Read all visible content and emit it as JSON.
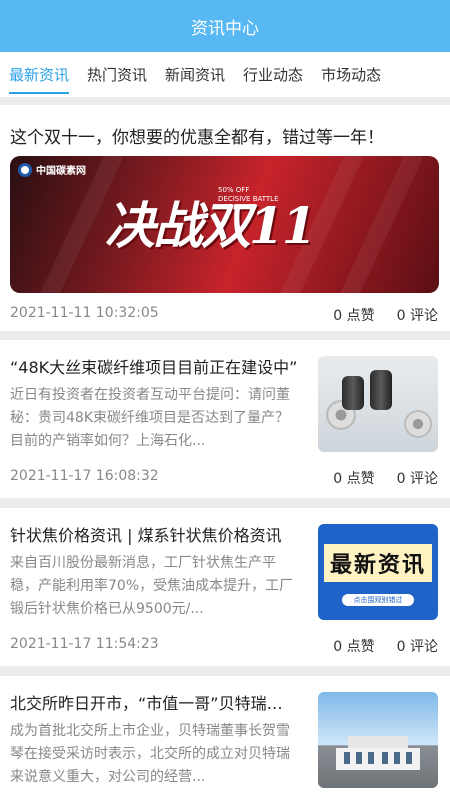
{
  "header": {
    "title": "资讯中心"
  },
  "tabs": [
    {
      "label": "最新资讯",
      "active": true
    },
    {
      "label": "热门资讯",
      "active": false
    },
    {
      "label": "新闻资讯",
      "active": false
    },
    {
      "label": "行业动态",
      "active": false
    },
    {
      "label": "市场动态",
      "active": false
    }
  ],
  "featured": {
    "title": "这个双十一，你想要的优惠全都有，错过等一年！",
    "banner": {
      "logo_text": "中国碳素网",
      "slogan": "决战双",
      "slogan_num": "11",
      "sub_line1": "50% OFF",
      "sub_line2": "DECISIVE BATTLE"
    },
    "date": "2021-11-11 10:32:05",
    "likes": "0 点赞",
    "comments": "0 评论"
  },
  "articles": [
    {
      "title": "“48K大丝束碳纤维项目目前正在建设中”",
      "desc": "近日有投资者在投资者互动平台提问：请问董秘：贵司48K束碳纤维项目是否达到了量产？目前的产销率如何？上海石化...",
      "date": "2021-11-17 16:08:32",
      "likes": "0 点赞",
      "comments": "0 评论",
      "thumb": "carbon-fiber-spools"
    },
    {
      "title": "针状焦价格资讯 | 煤系针状焦价格资讯",
      "desc": "来自百川股份最新消息，工厂针状焦生产平稳，产能利用率70%，受焦油成本提升，工厂锻后针状焦价格已从9500元/...",
      "date": "2021-11-17 11:54:23",
      "likes": "0 点赞",
      "comments": "0 评论",
      "thumb": "latest-news-banner",
      "thumb_text": "最新资讯",
      "thumb_sub": "点击围观别错过"
    },
    {
      "title": "北交所昨日开市，“市值一哥”贝特瑞…",
      "desc": "成为首批北交所上市企业，贝特瑞董事长贺雪琴在接受采访时表示，北交所的成立对贝特瑞来说意义重大，对公司的经营...",
      "thumb": "company-building"
    }
  ]
}
